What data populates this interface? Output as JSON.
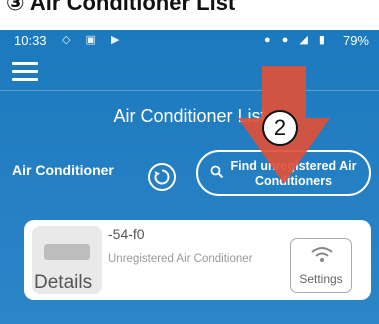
{
  "caption": "③ Air Conditioner List",
  "statusbar": {
    "time": "10:33",
    "battery": "79%"
  },
  "header": {
    "title": "Air Conditioner List"
  },
  "toolbar": {
    "section_label": "Air Conditioner",
    "find_button_label": "Find unregistered Air Conditioners"
  },
  "device": {
    "name": "-54-f0",
    "status": "Unregistered Air Conditioner",
    "details_label": "Details",
    "settings_label": "Settings"
  },
  "callout": {
    "number": "2"
  },
  "colors": {
    "header_blue": "#2a86c9",
    "callout_red": "#e0503a",
    "card_bg": "#ffffff"
  }
}
